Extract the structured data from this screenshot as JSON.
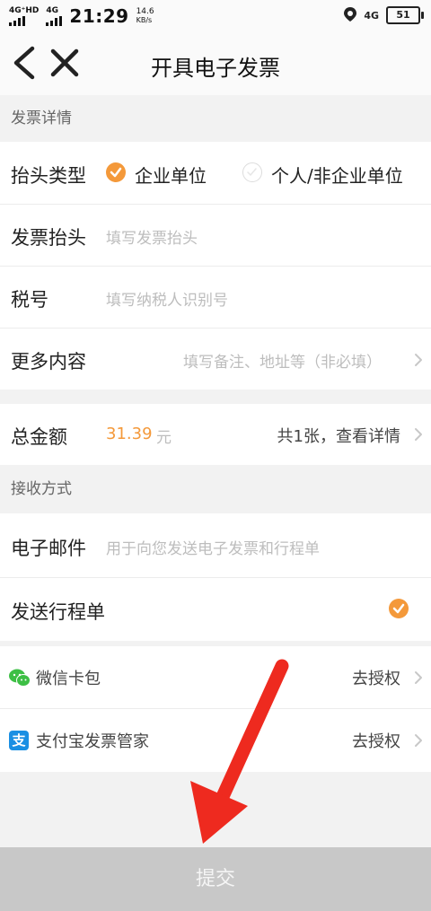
{
  "status_bar": {
    "network_left_1": "4G⁺HD",
    "network_left_2": "4G",
    "time": "21:29",
    "speed_value": "14.6",
    "speed_unit": "KB/s",
    "network_right": "4G",
    "battery": "51"
  },
  "nav": {
    "title": "开具电子发票"
  },
  "invoice_section": {
    "title": "发票详情",
    "header_type": {
      "label": "抬头类型",
      "option_company": "企业单位",
      "option_personal": "个人/非企业单位",
      "selected": "企业单位"
    },
    "invoice_header": {
      "label": "发票抬头",
      "placeholder": "填写发票抬头"
    },
    "tax_id": {
      "label": "税号",
      "placeholder": "填写纳税人识别号"
    },
    "more": {
      "label": "更多内容",
      "placeholder": "填写备注、地址等（非必填）"
    }
  },
  "total": {
    "label": "总金额",
    "amount": "31.39",
    "unit": "元",
    "detail": "共1张，查看详情"
  },
  "receive_section": {
    "title": "接收方式",
    "email": {
      "label": "电子邮件",
      "placeholder": "用于向您发送电子发票和行程单"
    },
    "itinerary": {
      "label": "发送行程单",
      "checked": true
    }
  },
  "wallets": [
    {
      "label": "微信卡包",
      "action": "去授权",
      "icon": "wechat-icon"
    },
    {
      "label": "支付宝发票管家",
      "action": "去授权",
      "icon": "alipay-icon",
      "icon_glyph": "支"
    }
  ],
  "submit_label": "提交",
  "colors": {
    "accent": "#f4993a",
    "arrow": "#ee2a1f",
    "submit_bg": "#c8c8c8",
    "wechat": "#3dbf45",
    "alipay": "#1a8fe3"
  }
}
